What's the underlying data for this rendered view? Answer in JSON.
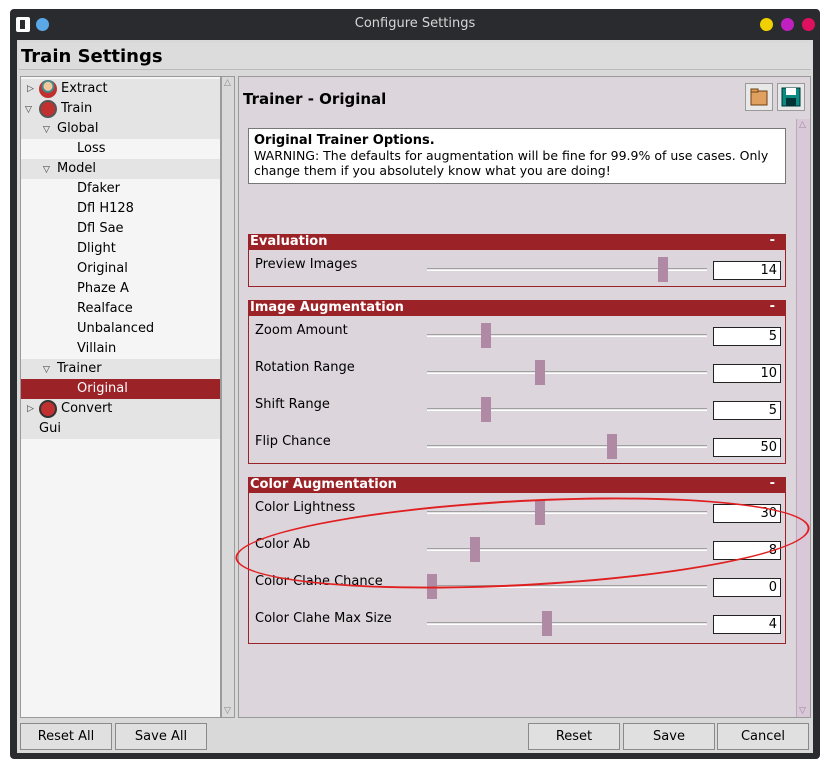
{
  "window": {
    "title": "Configure Settings",
    "controls": {
      "close_color": "#5aa8e6",
      "min_color": "#f0d000",
      "max_color": "#c020c0",
      "extra_color": "#e01060"
    }
  },
  "header": {
    "title": "Train Settings"
  },
  "tree": {
    "items": [
      {
        "label": "Extract"
      },
      {
        "label": "Train"
      },
      {
        "label": "Global"
      },
      {
        "label": "Loss"
      },
      {
        "label": "Model"
      },
      {
        "label": "Dfaker"
      },
      {
        "label": "Dfl H128"
      },
      {
        "label": "Dfl Sae"
      },
      {
        "label": "Dlight"
      },
      {
        "label": "Original"
      },
      {
        "label": "Phaze A"
      },
      {
        "label": "Realface"
      },
      {
        "label": "Unbalanced"
      },
      {
        "label": "Villain"
      },
      {
        "label": "Trainer"
      },
      {
        "label": "Original"
      },
      {
        "label": "Convert"
      },
      {
        "label": "Gui"
      }
    ]
  },
  "main": {
    "title": "Trainer - Original",
    "info": {
      "title": "Original Trainer Options.",
      "text": "WARNING: The defaults for augmentation will be fine for 99.9% of use cases. Only change them if you absolutely know what you are doing!"
    },
    "sections": [
      {
        "title": "Evaluation",
        "toggle": "-",
        "options": [
          {
            "label": "Preview Images",
            "value": "14"
          }
        ]
      },
      {
        "title": "Image Augmentation",
        "toggle": "-",
        "options": [
          {
            "label": "Zoom Amount",
            "value": "5"
          },
          {
            "label": "Rotation Range",
            "value": "10"
          },
          {
            "label": "Shift Range",
            "value": "5"
          },
          {
            "label": "Flip Chance",
            "value": "50"
          }
        ]
      },
      {
        "title": "Color Augmentation",
        "toggle": "-",
        "options": [
          {
            "label": "Color Lightness",
            "value": "30"
          },
          {
            "label": "Color Ab",
            "value": "8"
          },
          {
            "label": "Color Clahe Chance",
            "value": "0"
          },
          {
            "label": "Color Clahe Max Size",
            "value": "4"
          }
        ]
      }
    ]
  },
  "footer": {
    "reset_all": "Reset All",
    "save_all": "Save All",
    "reset": "Reset",
    "save": "Save",
    "cancel": "Cancel"
  },
  "colors": {
    "accent": "#9b2226",
    "slider_thumb": "#b08aa4"
  }
}
